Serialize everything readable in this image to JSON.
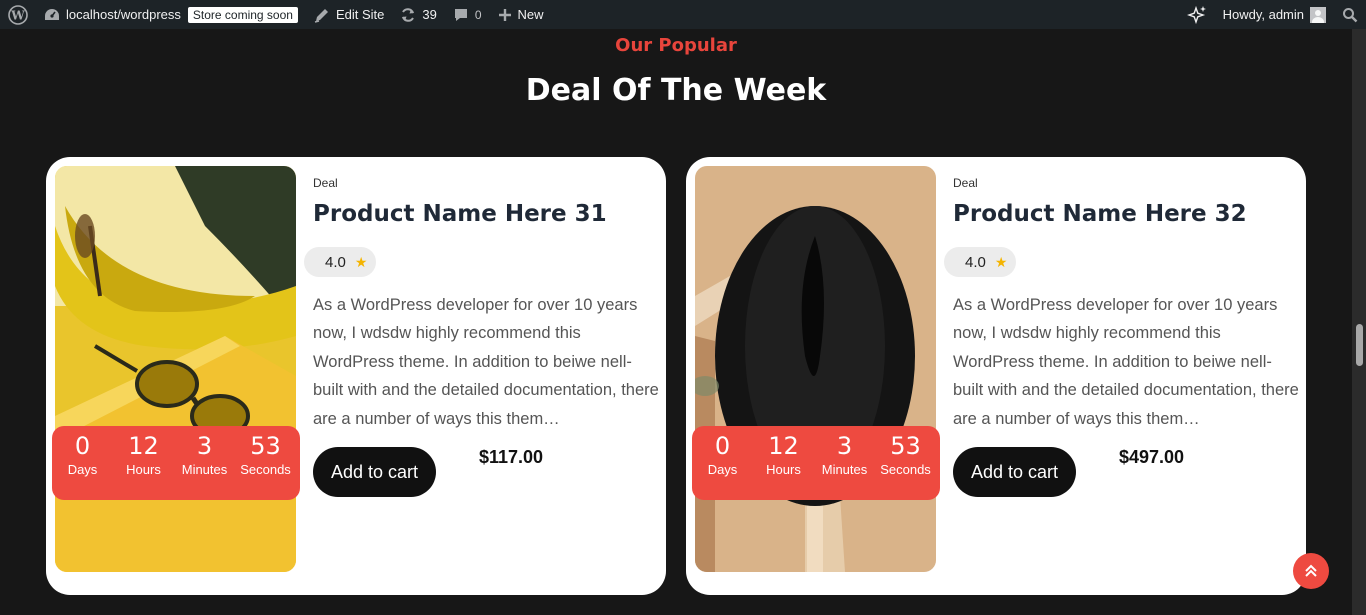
{
  "adminbar": {
    "site": "localhost/wordpress",
    "store_badge": "Store coming soon",
    "edit_site": "Edit Site",
    "updates": "39",
    "comments": "0",
    "new": "New",
    "howdy": "Howdy, admin"
  },
  "section": {
    "eyebrow": "Our Popular",
    "heading": "Deal Of The Week"
  },
  "products": [
    {
      "category": "Deal",
      "name": "Product Name Here 31",
      "rating": "4.0",
      "description": "As a WordPress developer for over 10 years now, I wdsdw highly recommend this WordPress theme. In addition to beiwe nell-built with and the detailed documentation, there are a number of ways this them…",
      "cart_label": "Add to cart",
      "price": "$117.00",
      "timer": {
        "days": "0",
        "hours": "12",
        "minutes": "3",
        "seconds": "53"
      },
      "image": "yellow-sunglasses-photo"
    },
    {
      "category": "Deal",
      "name": "Product Name Here 32",
      "rating": "4.0",
      "description": "As a WordPress developer for over 10 years now, I wdsdw highly recommend this WordPress theme. In addition to beiwe nell-built with and the detailed documentation, there are a number of ways this them…",
      "cart_label": "Add to cart",
      "price": "$497.00",
      "timer": {
        "days": "0",
        "hours": "12",
        "minutes": "3",
        "seconds": "53"
      },
      "image": "black-hat-photo"
    }
  ],
  "timer_labels": {
    "days": "Days",
    "hours": "Hours",
    "minutes": "Minutes",
    "seconds": "Seconds"
  },
  "colors": {
    "accent": "#ee4a40",
    "background": "#171717",
    "adminbar": "#1d2327"
  }
}
